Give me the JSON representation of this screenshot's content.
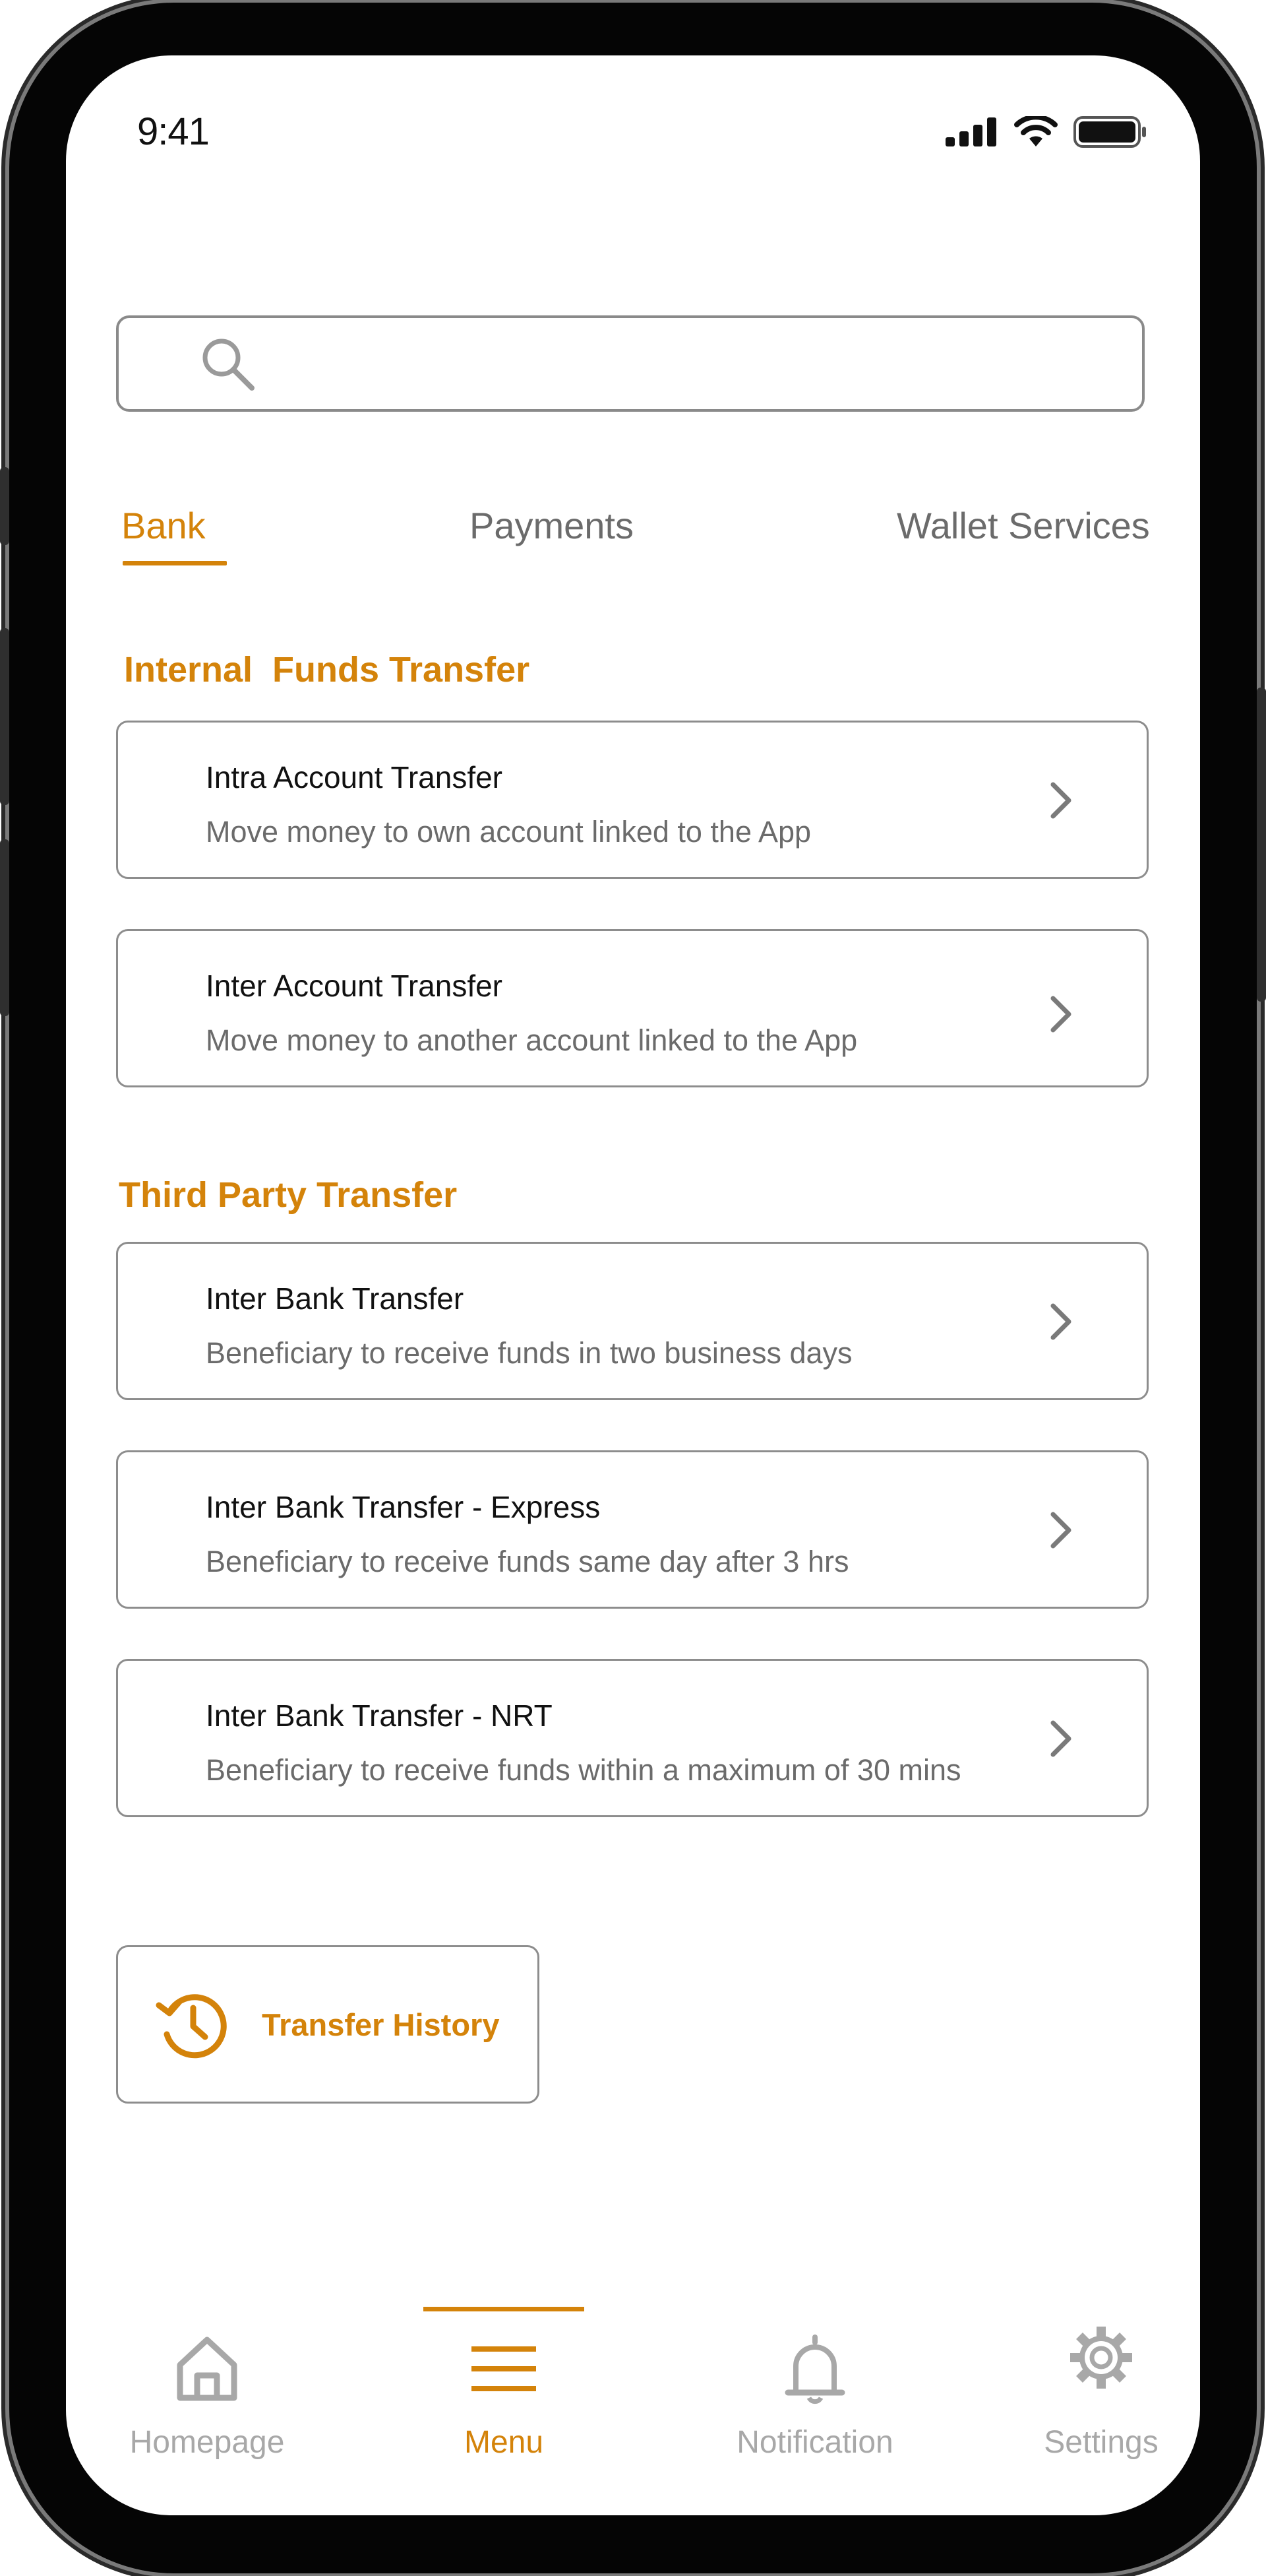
{
  "status_bar": {
    "time": "9:41"
  },
  "search": {
    "placeholder": ""
  },
  "tabs": [
    {
      "label": "Bank",
      "active": true
    },
    {
      "label": "Payments",
      "active": false
    },
    {
      "label": "Wallet Services",
      "active": false
    }
  ],
  "sections": {
    "internal": {
      "title": "Internal  Funds Transfer",
      "items": [
        {
          "title": "Intra Account Transfer",
          "subtitle": "Move money to own account linked to the App"
        },
        {
          "title": "Inter Account Transfer",
          "subtitle": "Move money to another account linked to the App"
        }
      ]
    },
    "third_party": {
      "title": "Third Party Transfer",
      "items": [
        {
          "title": "Inter Bank Transfer",
          "subtitle": "Beneficiary to receive funds in two business days"
        },
        {
          "title": "Inter Bank Transfer - Express",
          "subtitle": "Beneficiary to receive funds same day after 3 hrs"
        },
        {
          "title": "Inter Bank Transfer - NRT",
          "subtitle": "Beneficiary to receive funds within a maximum of 30 mins"
        }
      ]
    }
  },
  "transfer_history": {
    "label": "Transfer History",
    "icon": "history-icon"
  },
  "bottom_nav": [
    {
      "label": "Homepage",
      "icon": "home-icon",
      "active": false
    },
    {
      "label": "Menu",
      "icon": "menu-icon",
      "active": true
    },
    {
      "label": "Notification",
      "icon": "bell-icon",
      "active": false
    },
    {
      "label": "Settings",
      "icon": "gear-icon",
      "active": false
    }
  ],
  "colors": {
    "accent": "#d4830a",
    "muted": "#6b6b6b",
    "nav_inactive": "#a8a8a8",
    "border": "#8d8d8d"
  }
}
